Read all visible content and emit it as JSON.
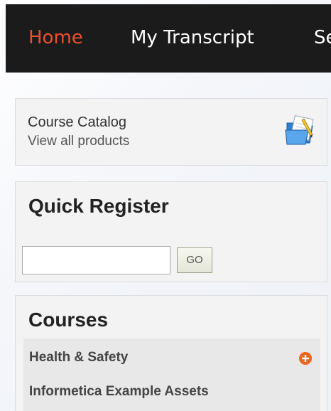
{
  "nav": {
    "items": [
      {
        "label": "Home",
        "active": true
      },
      {
        "label": "My Transcript",
        "active": false
      },
      {
        "label": "Se",
        "active": false
      }
    ],
    "active_color": "#e8512e",
    "background": "#1b1b1b"
  },
  "catalog": {
    "title": "Course Catalog",
    "subtitle": "View all products",
    "icon": "folder-open-icon"
  },
  "quick_register": {
    "heading": "Quick Register",
    "input_value": "",
    "go_label": "GO"
  },
  "courses": {
    "heading": "Courses",
    "items": [
      {
        "label": "Health & Safety",
        "icon": "expand-plus-icon"
      },
      {
        "label": "Informetica Example Assets"
      }
    ],
    "expand_color": "#e8661e"
  }
}
